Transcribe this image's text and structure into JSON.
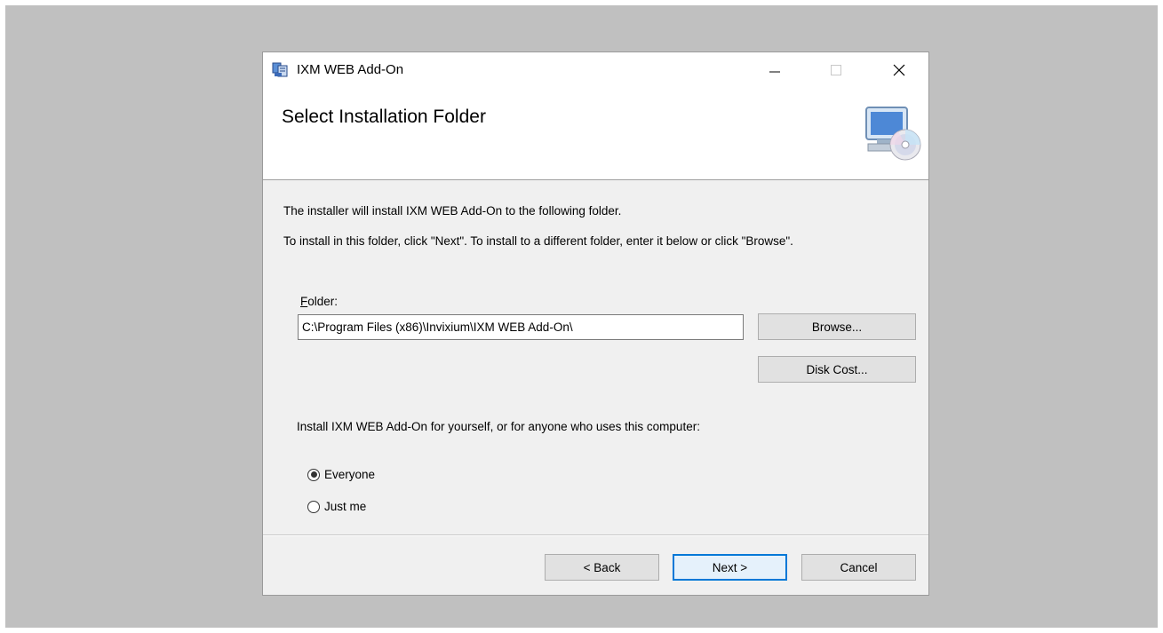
{
  "window": {
    "title": "IXM WEB Add-On",
    "minimize_glyph": "—",
    "maximize_glyph": "☐",
    "close_glyph": "✕"
  },
  "header": {
    "title": "Select Installation Folder",
    "icon": "computer-cd-icon"
  },
  "body": {
    "line1": "The installer will install IXM WEB Add-On to the following folder.",
    "line2": "To install in this folder, click \"Next\". To install to a different folder, enter it below or click \"Browse\".",
    "folder_label_first": "F",
    "folder_label_rest": "older:",
    "folder_value": "C:\\Program Files (x86)\\Invixium\\IXM WEB Add-On\\",
    "browse_label": "Browse...",
    "disk_cost_label": "Disk Cost...",
    "install_for_text": "Install IXM WEB Add-On for yourself, or for anyone who uses this computer:",
    "radio_options": [
      {
        "label": "Everyone",
        "selected": true
      },
      {
        "label": "Just me",
        "selected": false
      }
    ]
  },
  "footer": {
    "back_label": "< Back",
    "next_label": "Next >",
    "cancel_label": "Cancel"
  },
  "colors": {
    "backdrop": "#c0c0c0",
    "dialog": "#f0f0f0",
    "accent": "#0078d7"
  }
}
